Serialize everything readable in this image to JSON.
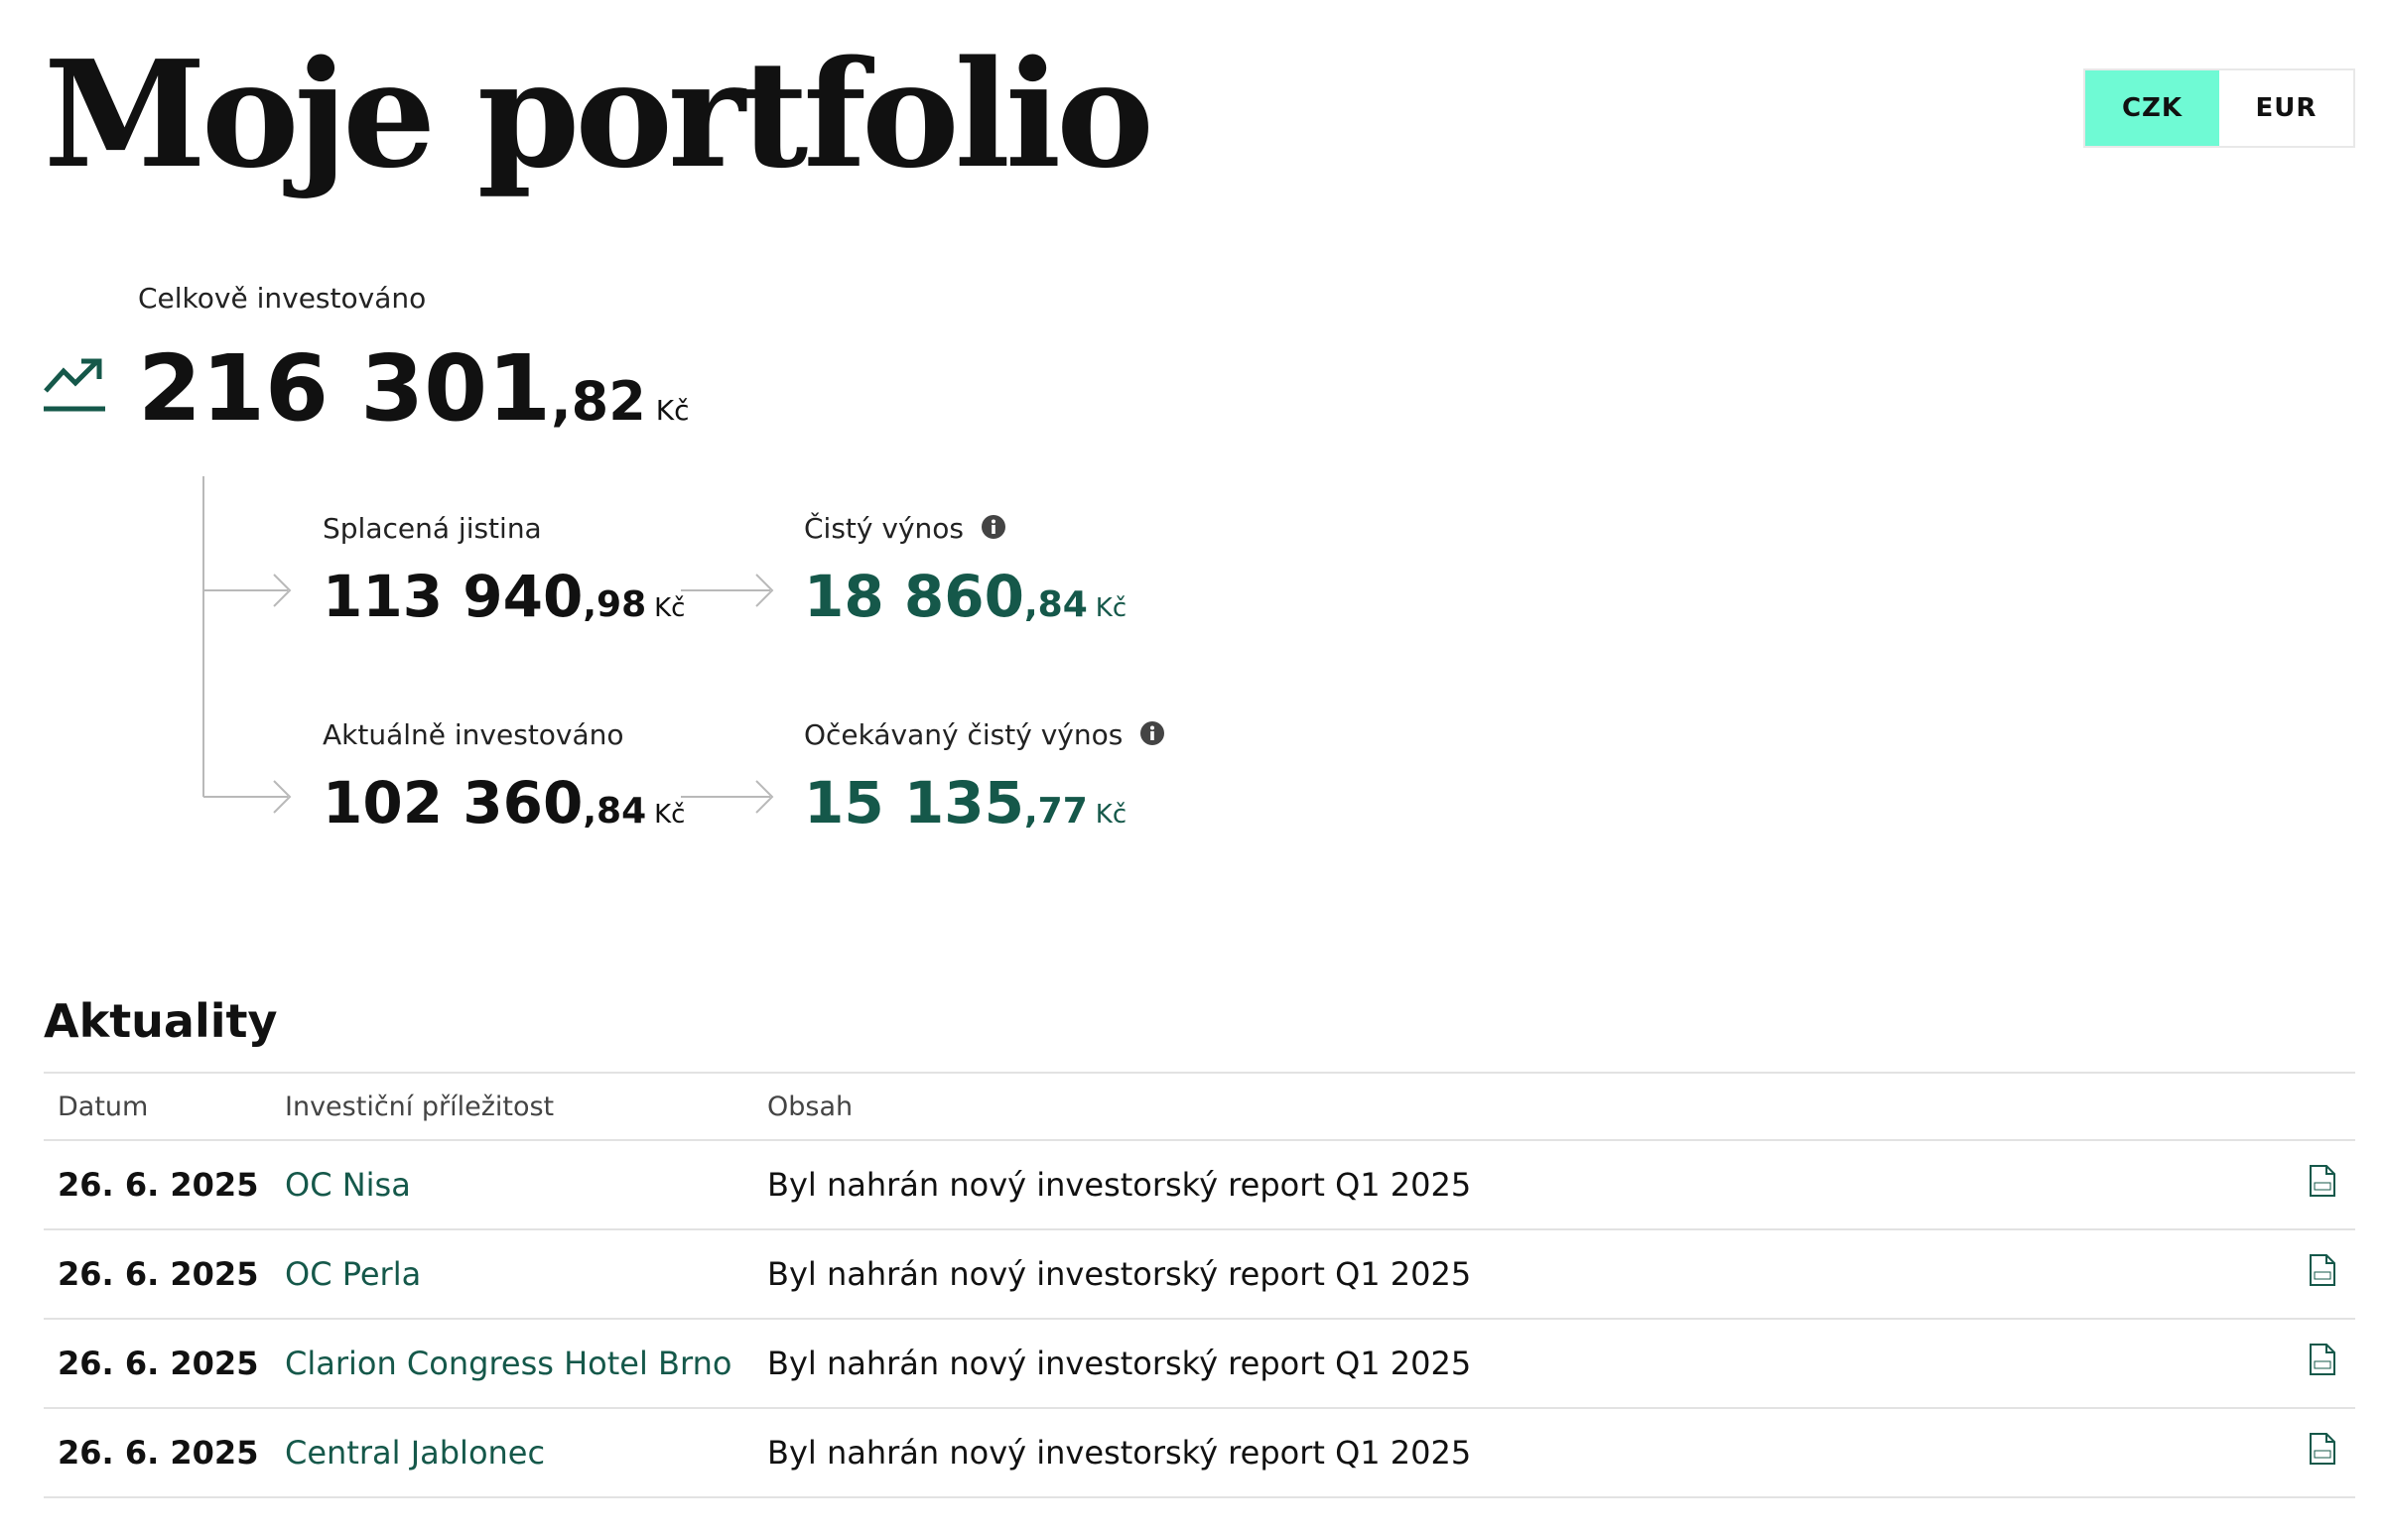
{
  "page": {
    "title": "Moje portfolio"
  },
  "currency": {
    "options": [
      "CZK",
      "EUR"
    ],
    "selected": "CZK",
    "active_color": "#6ffad4"
  },
  "summary": {
    "total": {
      "label": "Celkově investováno",
      "int": "216 301",
      "dec": ",82",
      "currency": "Kč"
    },
    "repaid": {
      "label": "Splacená jistina",
      "int": "113 940",
      "dec": ",98",
      "currency": "Kč"
    },
    "net_yield": {
      "label": "Čistý výnos",
      "int": "18 860",
      "dec": ",84",
      "currency": "Kč"
    },
    "current": {
      "label": "Aktuálně investováno",
      "int": "102 360",
      "dec": ",84",
      "currency": "Kč"
    },
    "expected_yield": {
      "label": "Očekávaný čistý výnos",
      "int": "15 135",
      "dec": ",77",
      "currency": "Kč"
    }
  },
  "icons": {
    "trend": "trending-up-icon",
    "info": "info-icon",
    "document": "pdf-file-icon"
  },
  "colors": {
    "accent_green": "#15584a",
    "toggle_active": "#6ffad4"
  },
  "news": {
    "title": "Aktuality",
    "columns": {
      "date": "Datum",
      "opportunity": "Investiční příležitost",
      "content": "Obsah"
    },
    "rows": [
      {
        "date": "26. 6. 2025",
        "opportunity": "OC Nisa",
        "content": "Byl nahrán nový investorský report Q1 2025"
      },
      {
        "date": "26. 6. 2025",
        "opportunity": "OC Perla",
        "content": "Byl nahrán nový investorský report Q1 2025"
      },
      {
        "date": "26. 6. 2025",
        "opportunity": "Clarion Congress Hotel Brno",
        "content": "Byl nahrán nový investorský report Q1 2025"
      },
      {
        "date": "26. 6. 2025",
        "opportunity": "Central Jablonec",
        "content": "Byl nahrán nový investorský report Q1 2025"
      }
    ]
  }
}
